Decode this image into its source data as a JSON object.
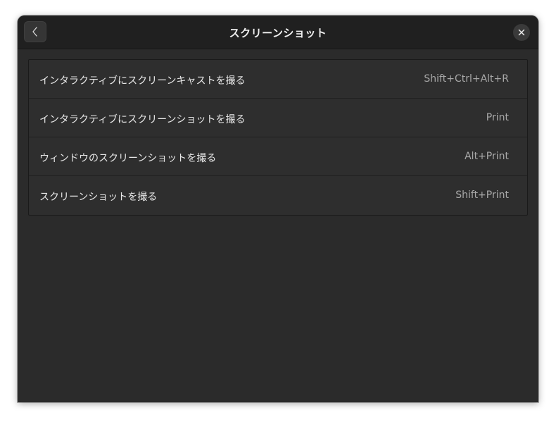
{
  "window": {
    "title": "スクリーンショット"
  },
  "headerbar": {
    "back_icon": "chevron-left-icon",
    "close_icon": "close-icon"
  },
  "shortcuts": [
    {
      "label": "インタラクティブにスクリーンキャストを撮る",
      "accel": "Shift+Ctrl+Alt+R"
    },
    {
      "label": "インタラクティブにスクリーンショットを撮る",
      "accel": "Print"
    },
    {
      "label": "ウィンドウのスクリーンショットを撮る",
      "accel": "Alt+Print"
    },
    {
      "label": "スクリーンショットを撮る",
      "accel": "Shift+Print"
    }
  ],
  "colors": {
    "window_bg": "#2b2b2b",
    "headerbar_bg": "#202020",
    "row_bg": "#2e2e2e",
    "text": "#e8e8e8",
    "accel_text": "#a8a8a8"
  }
}
